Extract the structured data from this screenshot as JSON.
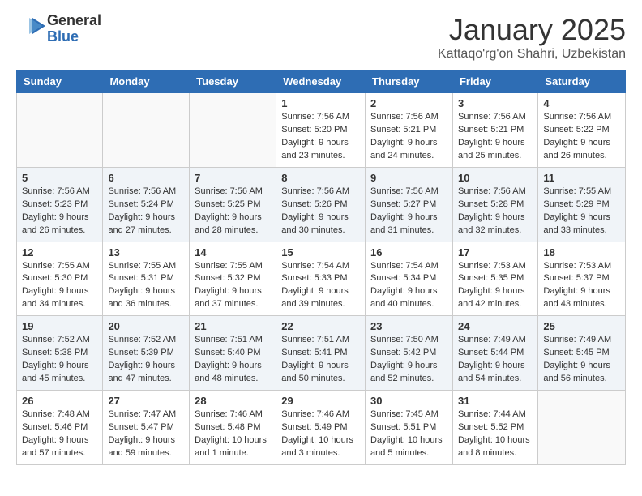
{
  "logo": {
    "general": "General",
    "blue": "Blue"
  },
  "header": {
    "month": "January 2025",
    "location": "Kattaqo'rg'on Shahri, Uzbekistan"
  },
  "weekdays": [
    "Sunday",
    "Monday",
    "Tuesday",
    "Wednesday",
    "Thursday",
    "Friday",
    "Saturday"
  ],
  "weeks": [
    [
      {
        "day": "",
        "info": ""
      },
      {
        "day": "",
        "info": ""
      },
      {
        "day": "",
        "info": ""
      },
      {
        "day": "1",
        "info": "Sunrise: 7:56 AM\nSunset: 5:20 PM\nDaylight: 9 hours and 23 minutes."
      },
      {
        "day": "2",
        "info": "Sunrise: 7:56 AM\nSunset: 5:21 PM\nDaylight: 9 hours and 24 minutes."
      },
      {
        "day": "3",
        "info": "Sunrise: 7:56 AM\nSunset: 5:21 PM\nDaylight: 9 hours and 25 minutes."
      },
      {
        "day": "4",
        "info": "Sunrise: 7:56 AM\nSunset: 5:22 PM\nDaylight: 9 hours and 26 minutes."
      }
    ],
    [
      {
        "day": "5",
        "info": "Sunrise: 7:56 AM\nSunset: 5:23 PM\nDaylight: 9 hours and 26 minutes."
      },
      {
        "day": "6",
        "info": "Sunrise: 7:56 AM\nSunset: 5:24 PM\nDaylight: 9 hours and 27 minutes."
      },
      {
        "day": "7",
        "info": "Sunrise: 7:56 AM\nSunset: 5:25 PM\nDaylight: 9 hours and 28 minutes."
      },
      {
        "day": "8",
        "info": "Sunrise: 7:56 AM\nSunset: 5:26 PM\nDaylight: 9 hours and 30 minutes."
      },
      {
        "day": "9",
        "info": "Sunrise: 7:56 AM\nSunset: 5:27 PM\nDaylight: 9 hours and 31 minutes."
      },
      {
        "day": "10",
        "info": "Sunrise: 7:56 AM\nSunset: 5:28 PM\nDaylight: 9 hours and 32 minutes."
      },
      {
        "day": "11",
        "info": "Sunrise: 7:55 AM\nSunset: 5:29 PM\nDaylight: 9 hours and 33 minutes."
      }
    ],
    [
      {
        "day": "12",
        "info": "Sunrise: 7:55 AM\nSunset: 5:30 PM\nDaylight: 9 hours and 34 minutes."
      },
      {
        "day": "13",
        "info": "Sunrise: 7:55 AM\nSunset: 5:31 PM\nDaylight: 9 hours and 36 minutes."
      },
      {
        "day": "14",
        "info": "Sunrise: 7:55 AM\nSunset: 5:32 PM\nDaylight: 9 hours and 37 minutes."
      },
      {
        "day": "15",
        "info": "Sunrise: 7:54 AM\nSunset: 5:33 PM\nDaylight: 9 hours and 39 minutes."
      },
      {
        "day": "16",
        "info": "Sunrise: 7:54 AM\nSunset: 5:34 PM\nDaylight: 9 hours and 40 minutes."
      },
      {
        "day": "17",
        "info": "Sunrise: 7:53 AM\nSunset: 5:35 PM\nDaylight: 9 hours and 42 minutes."
      },
      {
        "day": "18",
        "info": "Sunrise: 7:53 AM\nSunset: 5:37 PM\nDaylight: 9 hours and 43 minutes."
      }
    ],
    [
      {
        "day": "19",
        "info": "Sunrise: 7:52 AM\nSunset: 5:38 PM\nDaylight: 9 hours and 45 minutes."
      },
      {
        "day": "20",
        "info": "Sunrise: 7:52 AM\nSunset: 5:39 PM\nDaylight: 9 hours and 47 minutes."
      },
      {
        "day": "21",
        "info": "Sunrise: 7:51 AM\nSunset: 5:40 PM\nDaylight: 9 hours and 48 minutes."
      },
      {
        "day": "22",
        "info": "Sunrise: 7:51 AM\nSunset: 5:41 PM\nDaylight: 9 hours and 50 minutes."
      },
      {
        "day": "23",
        "info": "Sunrise: 7:50 AM\nSunset: 5:42 PM\nDaylight: 9 hours and 52 minutes."
      },
      {
        "day": "24",
        "info": "Sunrise: 7:49 AM\nSunset: 5:44 PM\nDaylight: 9 hours and 54 minutes."
      },
      {
        "day": "25",
        "info": "Sunrise: 7:49 AM\nSunset: 5:45 PM\nDaylight: 9 hours and 56 minutes."
      }
    ],
    [
      {
        "day": "26",
        "info": "Sunrise: 7:48 AM\nSunset: 5:46 PM\nDaylight: 9 hours and 57 minutes."
      },
      {
        "day": "27",
        "info": "Sunrise: 7:47 AM\nSunset: 5:47 PM\nDaylight: 9 hours and 59 minutes."
      },
      {
        "day": "28",
        "info": "Sunrise: 7:46 AM\nSunset: 5:48 PM\nDaylight: 10 hours and 1 minute."
      },
      {
        "day": "29",
        "info": "Sunrise: 7:46 AM\nSunset: 5:49 PM\nDaylight: 10 hours and 3 minutes."
      },
      {
        "day": "30",
        "info": "Sunrise: 7:45 AM\nSunset: 5:51 PM\nDaylight: 10 hours and 5 minutes."
      },
      {
        "day": "31",
        "info": "Sunrise: 7:44 AM\nSunset: 5:52 PM\nDaylight: 10 hours and 8 minutes."
      },
      {
        "day": "",
        "info": ""
      }
    ]
  ]
}
